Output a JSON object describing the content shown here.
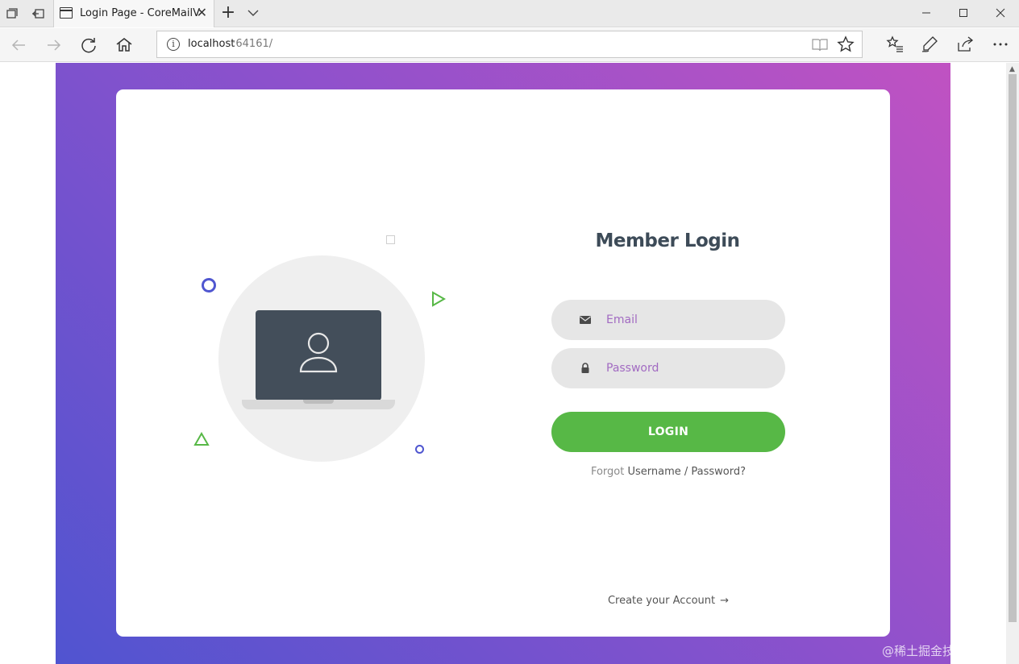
{
  "browser": {
    "tab_title": "Login Page - CoreMailV",
    "new_tab": "+",
    "tab_close": "✕",
    "address_host": "localhost",
    "address_rest": ":64161/"
  },
  "login": {
    "title": "Member Login",
    "email_placeholder": "Email",
    "password_placeholder": "Password",
    "button_label": "LOGIN",
    "forgot_prefix": "Forgot",
    "forgot_link": "Username / Password?",
    "create_account": "Create your Account",
    "create_arrow": "→"
  },
  "watermark": "@稀土掘金技术社区",
  "colors": {
    "gradient_start": "#c052c2",
    "gradient_end": "#5054d0",
    "button_green": "#57b846",
    "title_color": "#3d4b58",
    "field_bg": "#e6e6e6",
    "placeholder": "#a26bc2",
    "laptop_screen": "#434e5a"
  },
  "icons": {
    "tabs_aside": "tabs-aside-icon",
    "set_aside": "set-aside-icon",
    "tab_page": "page-icon",
    "tab_list": "chevron-down-icon",
    "back": "back-arrow-icon",
    "forward": "forward-arrow-icon",
    "refresh": "refresh-icon",
    "home": "home-icon",
    "site_info": "info-icon",
    "reading_view": "reading-view-icon",
    "favorite": "star-icon",
    "favorites_hub": "favorites-list-icon",
    "web_note": "pen-icon",
    "share": "share-icon",
    "more": "more-icon",
    "email_field": "envelope-icon",
    "password_field": "lock-icon",
    "user": "user-icon"
  }
}
